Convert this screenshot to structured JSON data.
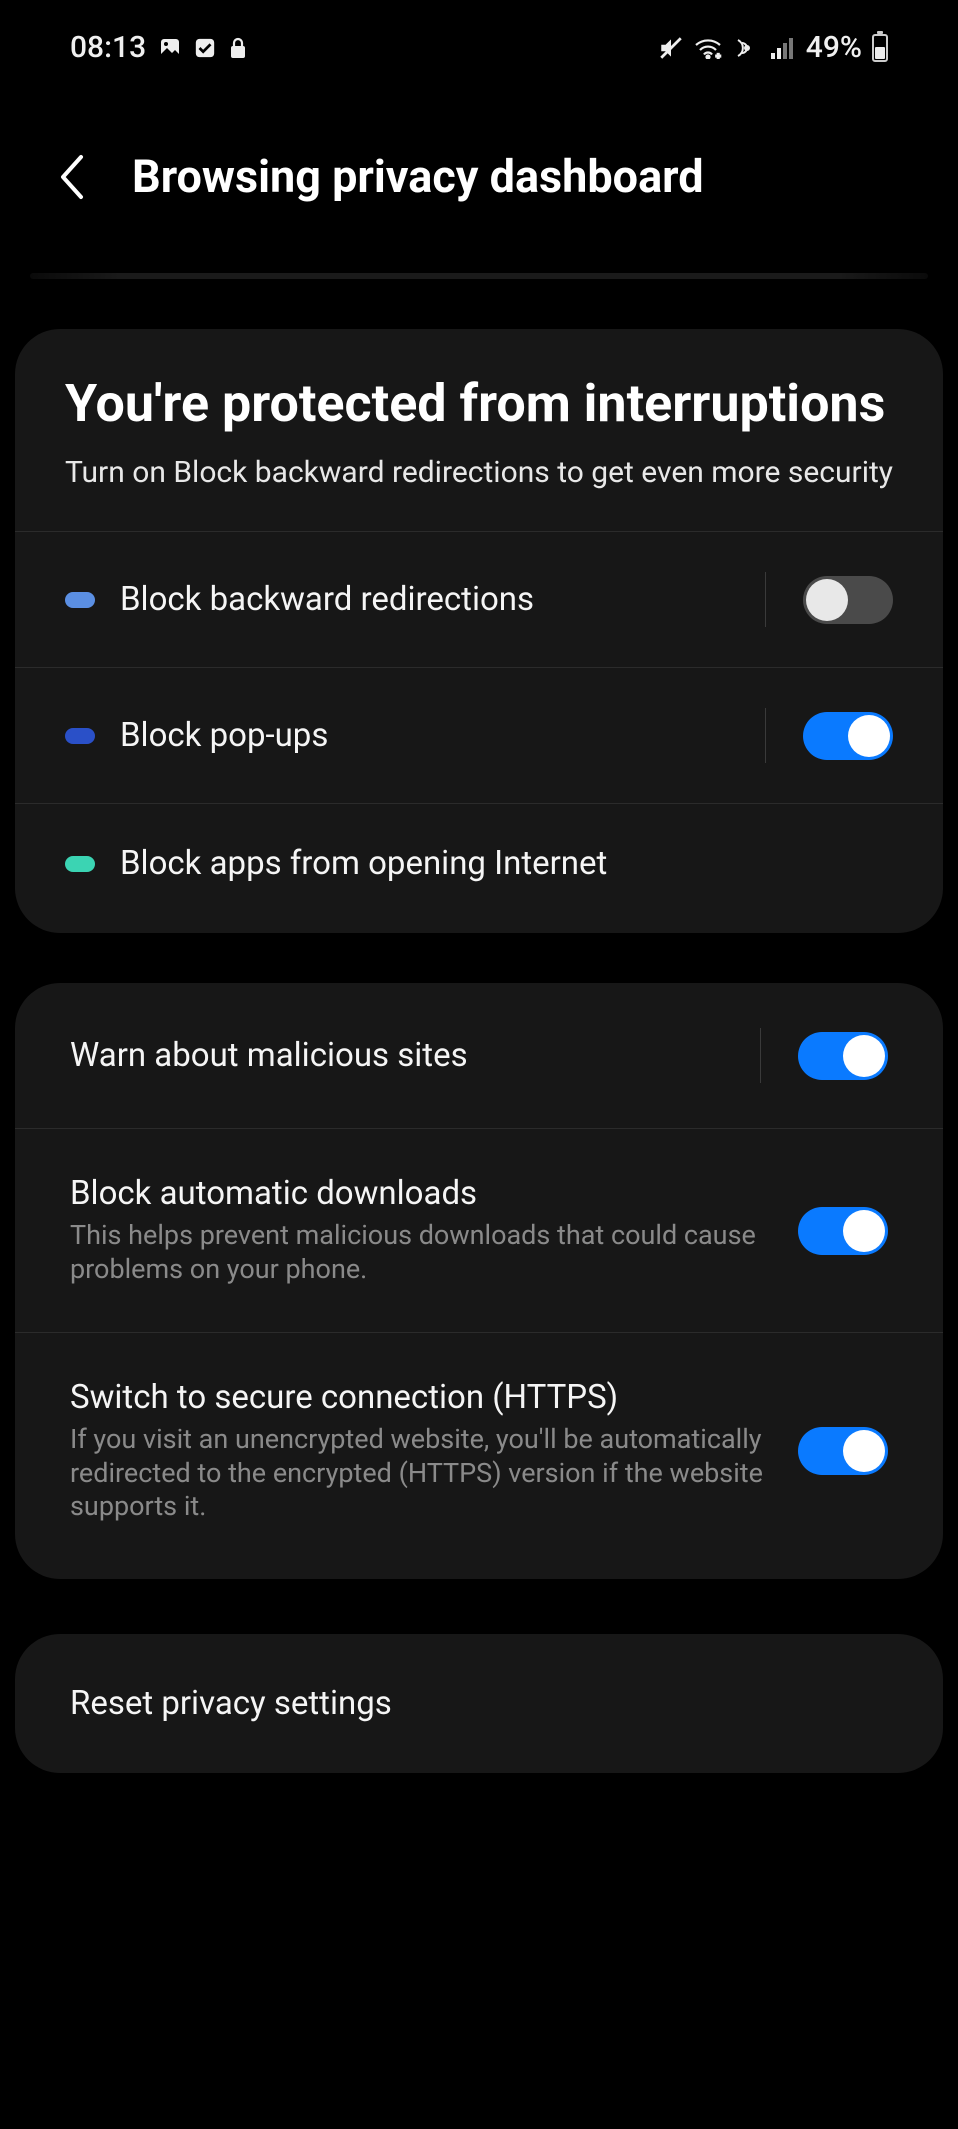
{
  "status": {
    "time": "08:13",
    "battery_pct": "49%"
  },
  "header": {
    "title": "Browsing privacy dashboard"
  },
  "card1": {
    "title": "You're protected from interruptions",
    "subtitle": "Turn on Block backward redirections to get even more security",
    "items": [
      {
        "label": "Block backward redirections"
      },
      {
        "label": "Block pop-ups"
      },
      {
        "label": "Block apps from opening Internet"
      }
    ]
  },
  "card2": {
    "items": [
      {
        "label": "Warn about malicious sites",
        "desc": ""
      },
      {
        "label": "Block automatic downloads",
        "desc": "This helps prevent malicious downloads that could cause problems on your phone."
      },
      {
        "label": "Switch to secure connection (HTTPS)",
        "desc": "If you visit an unencrypted website, you'll be automatically redirected to the encrypted (HTTPS) version if the website supports it."
      }
    ]
  },
  "reset": {
    "label": "Reset privacy settings"
  }
}
